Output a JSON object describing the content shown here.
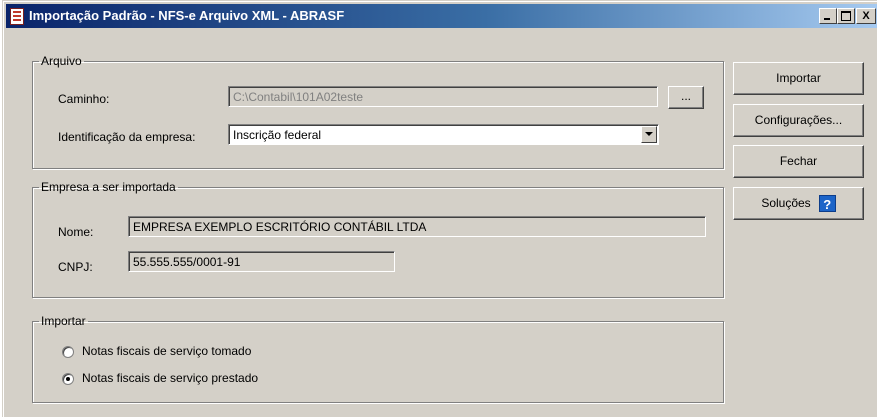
{
  "window": {
    "title": "Importação Padrão - NFS-e Arquivo XML - ABRASF",
    "controls": {
      "minimize": "_",
      "maximize": "□",
      "close": "X"
    }
  },
  "arquivo": {
    "legend": "Arquivo",
    "caminho_label": "Caminho:",
    "caminho_value": "C:\\Contabil\\101A02teste",
    "browse_label": "...",
    "identificacao_label": "Identificação da empresa:",
    "identificacao_value": "Inscrição federal"
  },
  "empresa": {
    "legend": "Empresa a ser importada",
    "nome_label": "Nome:",
    "nome_value": "EMPRESA EXEMPLO ESCRITÓRIO CONTÁBIL LTDA",
    "cnpj_label": "CNPJ:",
    "cnpj_value": "55.555.555/0001-91"
  },
  "importar": {
    "legend": "Importar",
    "options": [
      {
        "label": "Notas fiscais de serviço tomado",
        "checked": false
      },
      {
        "label": "Notas fiscais de serviço prestado",
        "checked": true
      }
    ]
  },
  "buttons": {
    "importar": "Importar",
    "configuracoes": "Configurações...",
    "fechar": "Fechar",
    "solucoes": "Soluções",
    "help_glyph": "?"
  }
}
